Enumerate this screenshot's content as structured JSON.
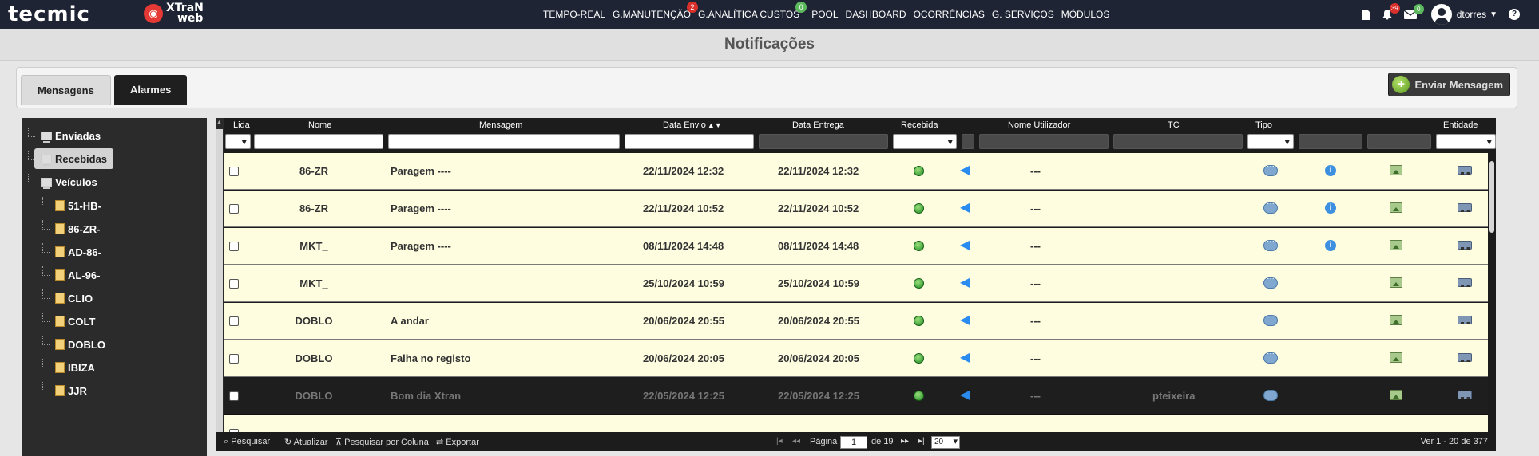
{
  "brand": {
    "logo": "tecmic",
    "product_line1": "XTraN",
    "product_line2": "web"
  },
  "nav": {
    "items": [
      {
        "label": "TEMPO-REAL",
        "badge": ""
      },
      {
        "label": "G.MANUTENÇÃO",
        "badge": "2"
      },
      {
        "label": "G.ANALÍTICA CUSTOS",
        "badge": "0"
      },
      {
        "label": "POOL",
        "badge": ""
      },
      {
        "label": "DASHBOARD",
        "badge": ""
      },
      {
        "label": "OCORRÊNCIAS",
        "badge": ""
      },
      {
        "label": "G. SERVIÇOS",
        "badge": ""
      },
      {
        "label": "MÓDULOS",
        "badge": ""
      }
    ],
    "alerts_count": "39",
    "messages_count": "0",
    "user": "dtorres",
    "help": "?"
  },
  "page": {
    "title": "Notificações"
  },
  "tabs": {
    "messages": "Mensagens",
    "alarms": "Alarmes",
    "send_button": "Enviar Mensagem"
  },
  "tree": {
    "sent": "Enviadas",
    "received": "Recebidas",
    "vehicles": "Veículos",
    "vehicle_list": [
      "51-HB-",
      "86-ZR-",
      "AD-86-",
      "AL-96-",
      "CLIO",
      "COLT",
      "DOBLO",
      "IBIZA",
      "JJR"
    ]
  },
  "grid": {
    "columns": {
      "read": "Lida",
      "name": "Nome",
      "message": "Mensagem",
      "sent_date": "Data Envio",
      "delivery_date": "Data Entrega",
      "received": "Recebida",
      "user_name": "Nome Utilizador",
      "tc": "TC",
      "type": "Tipo",
      "entity": "Entidade"
    },
    "rows": [
      {
        "name": "86-ZR",
        "message": "Paragem ----",
        "sent": "22/11/2024 12:32",
        "delivered": "22/11/2024 12:32",
        "user": "---",
        "tc": "",
        "info": true
      },
      {
        "name": "86-ZR",
        "message": "Paragem ----",
        "sent": "22/11/2024 10:52",
        "delivered": "22/11/2024 10:52",
        "user": "---",
        "tc": "",
        "info": true
      },
      {
        "name": "MKT_",
        "message": "Paragem ----",
        "sent": "08/11/2024 14:48",
        "delivered": "08/11/2024 14:48",
        "user": "---",
        "tc": "",
        "info": true
      },
      {
        "name": "MKT_",
        "message": "",
        "sent": "25/10/2024 10:59",
        "delivered": "25/10/2024 10:59",
        "user": "---",
        "tc": "",
        "info": false
      },
      {
        "name": "DOBLO",
        "message": "A andar",
        "sent": "20/06/2024 20:55",
        "delivered": "20/06/2024 20:55",
        "user": "---",
        "tc": "",
        "info": false
      },
      {
        "name": "DOBLO",
        "message": "Falha no registo",
        "sent": "20/06/2024 20:05",
        "delivered": "20/06/2024 20:05",
        "user": "---",
        "tc": "",
        "info": false
      },
      {
        "name": "DOBLO",
        "message": "Bom dia Xtran",
        "sent": "22/05/2024 12:25",
        "delivered": "22/05/2024 12:25",
        "user": "---",
        "tc": "pteixeira",
        "info": false
      }
    ],
    "selected_row_index": 6
  },
  "pager": {
    "search": "Pesquisar",
    "refresh": "Atualizar",
    "column_search": "Pesquisar por Coluna",
    "export": "Exportar",
    "page_label": "Página",
    "page_value": "1",
    "of_label": "de 19",
    "page_size": "20",
    "record_info": "Ver 1 - 20 de 377"
  }
}
